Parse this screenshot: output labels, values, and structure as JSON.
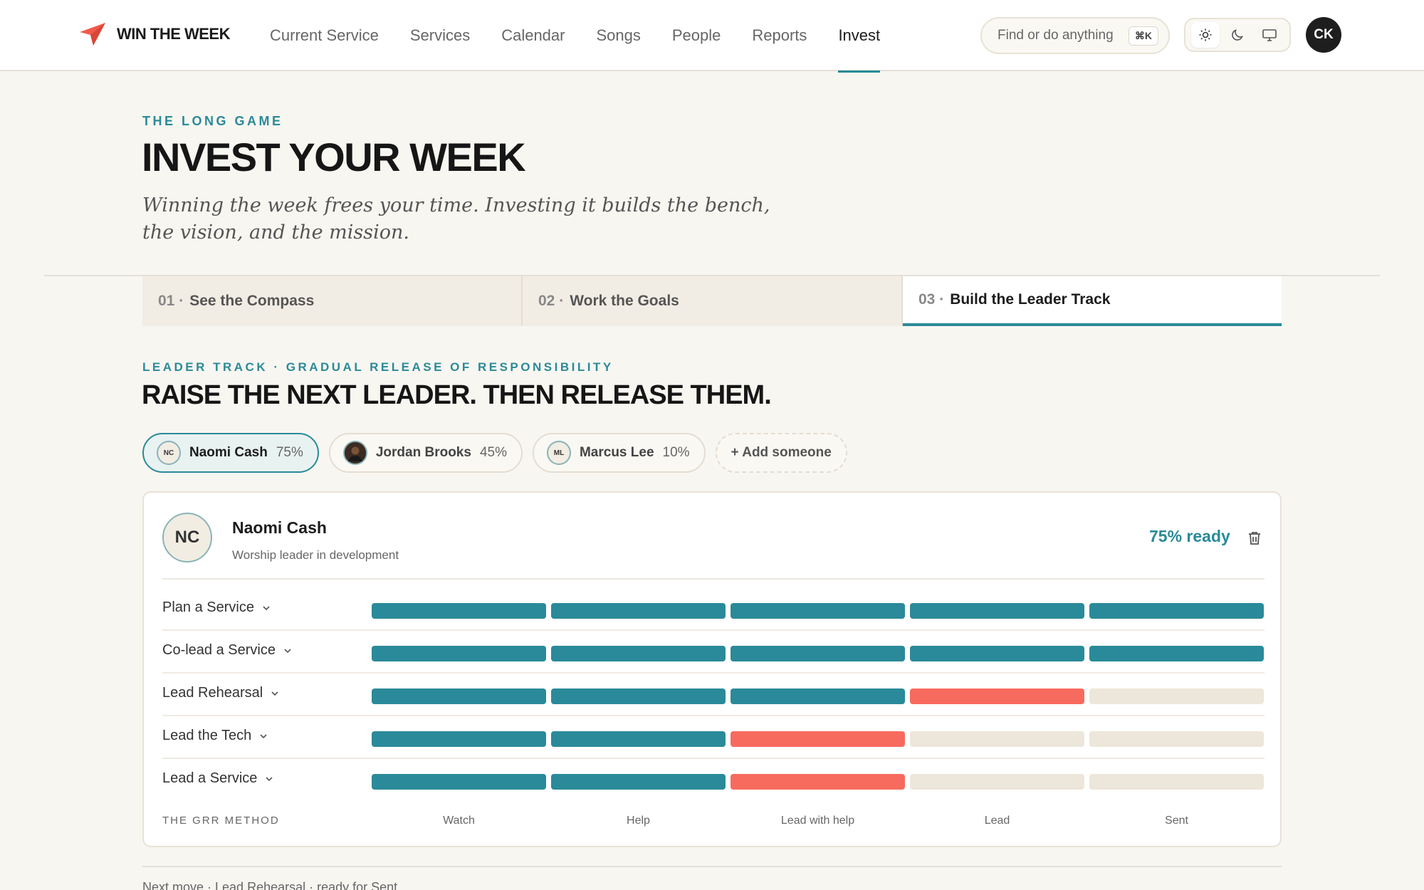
{
  "header": {
    "brand": "WIN THE WEEK",
    "nav": [
      "Current Service",
      "Services",
      "Calendar",
      "Songs",
      "People",
      "Reports",
      "Invest"
    ],
    "active_nav": "Invest",
    "search_placeholder": "Find or do anything",
    "search_shortcut": "⌘K",
    "theme_modes": [
      "light-mode-icon",
      "dark-mode-icon",
      "system-mode-icon"
    ],
    "user_initials": "CK"
  },
  "hero": {
    "eyebrow": "THE LONG GAME",
    "title": "INVEST YOUR WEEK",
    "subtitle": "Winning the week frees your time. Investing it builds the bench, the vision, and the mission."
  },
  "steps": [
    {
      "num": "01 ·",
      "label": "See the Compass",
      "active": false
    },
    {
      "num": "02 ·",
      "label": "Work the Goals",
      "active": false
    },
    {
      "num": "03 ·",
      "label": "Build the Leader Track",
      "active": true
    }
  ],
  "section": {
    "eyebrow": "LEADER TRACK · GRADUAL RELEASE OF RESPONSIBILITY",
    "title": "RAISE THE NEXT LEADER. THEN RELEASE THEM."
  },
  "people": [
    {
      "initials": "NC",
      "name": "Naomi Cash",
      "pct": "75%",
      "active": true
    },
    {
      "initials": "",
      "name": "Jordan Brooks",
      "pct": "45%",
      "active": false
    },
    {
      "initials": "ML",
      "name": "Marcus Lee",
      "pct": "10%",
      "active": false
    }
  ],
  "add_person_label": "+ Add someone",
  "card": {
    "initials": "NC",
    "name": "Naomi Cash",
    "role": "Worship leader in development",
    "ready": "75% ready",
    "skills": [
      {
        "label": "Plan a Service",
        "stages_done": 5,
        "current_stage": 0
      },
      {
        "label": "Co-lead a Service",
        "stages_done": 5,
        "current_stage": 0
      },
      {
        "label": "Lead Rehearsal",
        "stages_done": 3,
        "current_stage": 4
      },
      {
        "label": "Lead the Tech",
        "stages_done": 2,
        "current_stage": 3
      },
      {
        "label": "Lead a Service",
        "stages_done": 2,
        "current_stage": 3
      }
    ],
    "method_label": "THE GRR METHOD",
    "stages": [
      "Watch",
      "Help",
      "Lead with help",
      "Lead",
      "Sent"
    ]
  },
  "next_move": "Next move · Lead Rehearsal · ready for Sent",
  "colors": {
    "accent": "#2a8a99",
    "current": "#f76b5e",
    "pending": "#ede6da",
    "brand": "#f05a4b"
  }
}
